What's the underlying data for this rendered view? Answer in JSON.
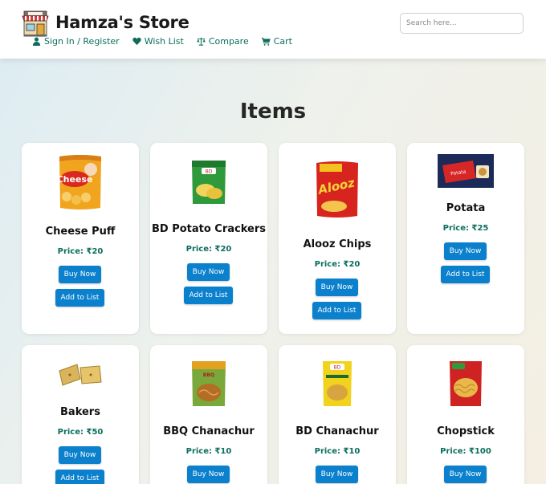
{
  "header": {
    "store_name": "Hamza's Store",
    "nav": [
      {
        "label": "Sign In / Register",
        "icon": "user-icon"
      },
      {
        "label": "Wish List",
        "icon": "heart-icon"
      },
      {
        "label": "Compare",
        "icon": "scale-icon"
      },
      {
        "label": "Cart",
        "icon": "cart-icon"
      }
    ],
    "search_placeholder": "Search here..."
  },
  "page_heading": "Items",
  "buy_label": "Buy Now",
  "add_label": "Add to List",
  "products": [
    {
      "name": "Cheese Puff",
      "price": "Price: ₹20",
      "image": "cheese-puff-image"
    },
    {
      "name": "BD Potato Crackers",
      "price": "Price: ₹20",
      "image": "potato-crackers-image"
    },
    {
      "name": "Alooz Chips",
      "price": "Price: ₹20",
      "image": "alooz-chips-image"
    },
    {
      "name": "Potata",
      "price": "Price: ₹25",
      "image": "potata-image"
    },
    {
      "name": "Bakers",
      "price": "Price: ₹50",
      "image": "bakers-image"
    },
    {
      "name": "BBQ Chanachur",
      "price": "Price: ₹10",
      "image": "bbq-chanachur-image"
    },
    {
      "name": "BD Chanachur",
      "price": "Price: ₹10",
      "image": "bd-chanachur-image"
    },
    {
      "name": "Chopstick",
      "price": "Price: ₹100",
      "image": "chopstick-image"
    }
  ],
  "colors": {
    "accent": "#0b6e5c",
    "button": "#0b80cc"
  }
}
